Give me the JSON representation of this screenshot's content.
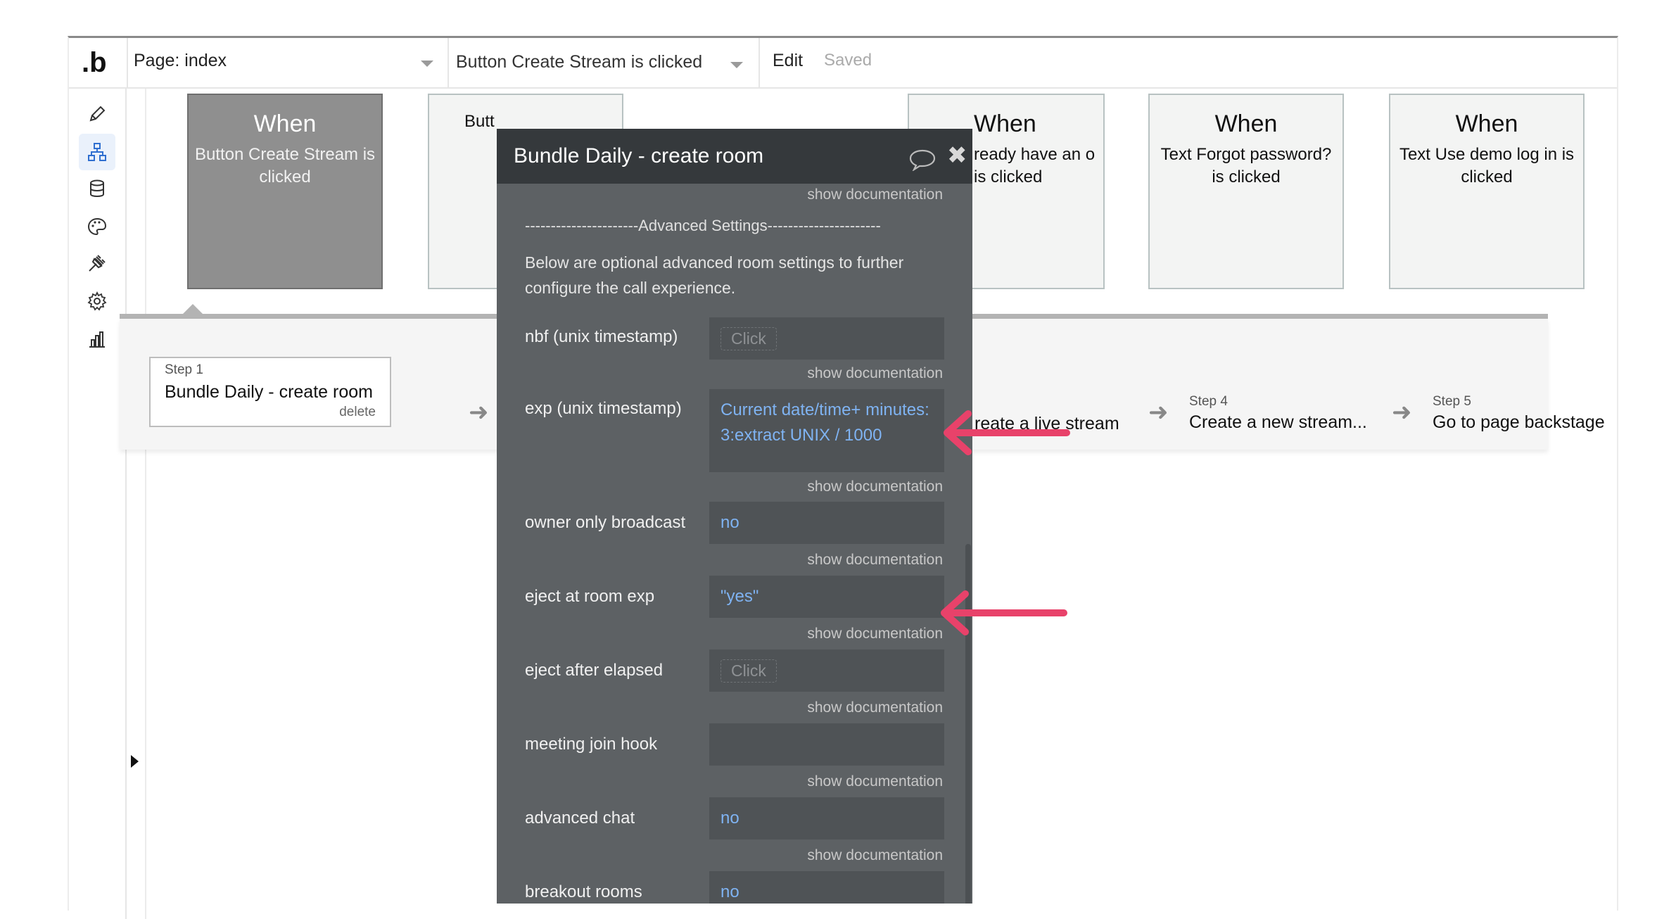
{
  "topbar": {
    "logo": ".b",
    "page_label": "Page: index",
    "event_label": "Button Create Stream is clicked",
    "edit_label": "Edit",
    "saved_label": "Saved"
  },
  "sidebar": {
    "icons": [
      "pencil-icon",
      "workflow-icon",
      "database-icon",
      "palette-icon",
      "plugin-icon",
      "settings-icon",
      "chart-icon"
    ],
    "active": "workflow-icon"
  },
  "cards": [
    {
      "when": "When",
      "cond": "Button Create Stream is clicked",
      "selected": true
    },
    {
      "when": "",
      "cond": "Butt"
    },
    {
      "when": "When",
      "cond": "ready have an o is clicked"
    },
    {
      "when": "When",
      "cond": "Text Forgot password? is clicked"
    },
    {
      "when": "When",
      "cond": "Text Use demo log in is clicked"
    }
  ],
  "steps": {
    "step1": {
      "num": "Step 1",
      "title": "Bundle Daily - create room",
      "delete": "delete"
    },
    "step3_partial": "reate a live stream",
    "step4": {
      "num": "Step 4",
      "title": "Create a new stream..."
    },
    "step5": {
      "num": "Step 5",
      "title": "Go to page backstage"
    }
  },
  "modal": {
    "title": "Bundle Daily - create room",
    "show_doc": "show documentation",
    "advanced": "----------------------Advanced Settings----------------------",
    "description": "Below are optional advanced room settings to further configure the call experience.",
    "fields": [
      {
        "label": "nbf (unix timestamp)",
        "value": "Click",
        "type": "click"
      },
      {
        "label": "exp (unix timestamp)",
        "value": "Current date/time+ minutes: 3:extract UNIX / 1000",
        "type": "value"
      },
      {
        "label": "owner only broadcast",
        "value": "no",
        "type": "value"
      },
      {
        "label": "eject at room exp",
        "value": "\"yes\"",
        "type": "value"
      },
      {
        "label": "eject after elapsed",
        "value": "Click",
        "type": "click"
      },
      {
        "label": "meeting join hook",
        "value": "",
        "type": "empty"
      },
      {
        "label": "advanced chat",
        "value": "no",
        "type": "value"
      },
      {
        "label": "breakout rooms",
        "value": "no",
        "type": "value"
      }
    ]
  },
  "colors": {
    "modal_bg": "#5d6164",
    "modal_header": "#35393c",
    "value_blue": "#7fb3f2",
    "annotation_arrow": "#e8426a"
  }
}
